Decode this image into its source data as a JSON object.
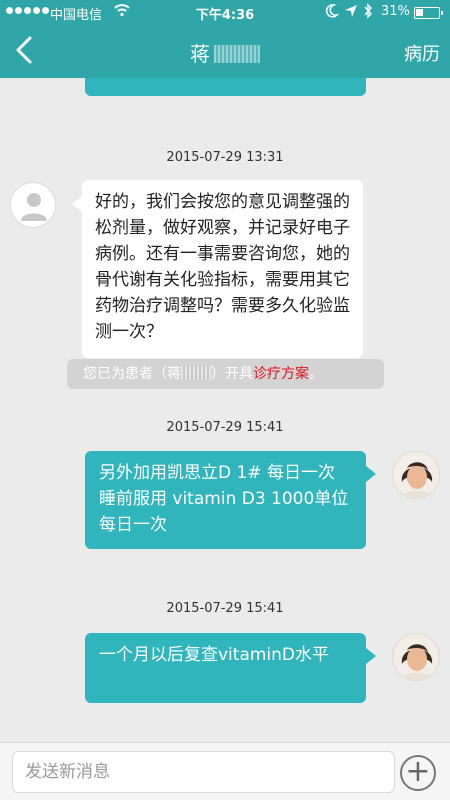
{
  "status_bar": {
    "carrier": "中国电信",
    "time": "下午4:36",
    "battery_percent": "31%",
    "battery_level": 0.31
  },
  "nav": {
    "back_icon": "chevron-left-icon",
    "title": "蒋",
    "right_label": "病历"
  },
  "messages": [
    {
      "timestamp": "2015-07-29 13:31",
      "direction": "incoming",
      "text": "好的，我们会按您的意见调整强的松剂量，做好观察，并记录好电子病例。还有一事需要咨询您，她的骨代谢有关化验指标，需要用其它药物治疗调整吗？需要多久化验监测一次？"
    },
    {
      "timestamp": "2015-07-29 15:41",
      "direction": "outgoing",
      "text": "另外加用凯思立D 1# 每日一次 睡前服用 vitamin D3 1000单位 每日一次"
    },
    {
      "timestamp": "2015-07-29 15:41",
      "direction": "outgoing",
      "text": "一个月以后复查vitaminD水平"
    }
  ],
  "notice": {
    "prefix": "您已为患者（蒋",
    "suffix": "）开具",
    "link": "诊疗方案",
    "end": "。"
  },
  "input": {
    "placeholder": "发送新消息",
    "plus_icon": "plus-circle-icon"
  },
  "colors": {
    "header": "#2fa7a9",
    "outgoing_bubble": "#2fb5bb",
    "notice_link": "#e0141e"
  }
}
